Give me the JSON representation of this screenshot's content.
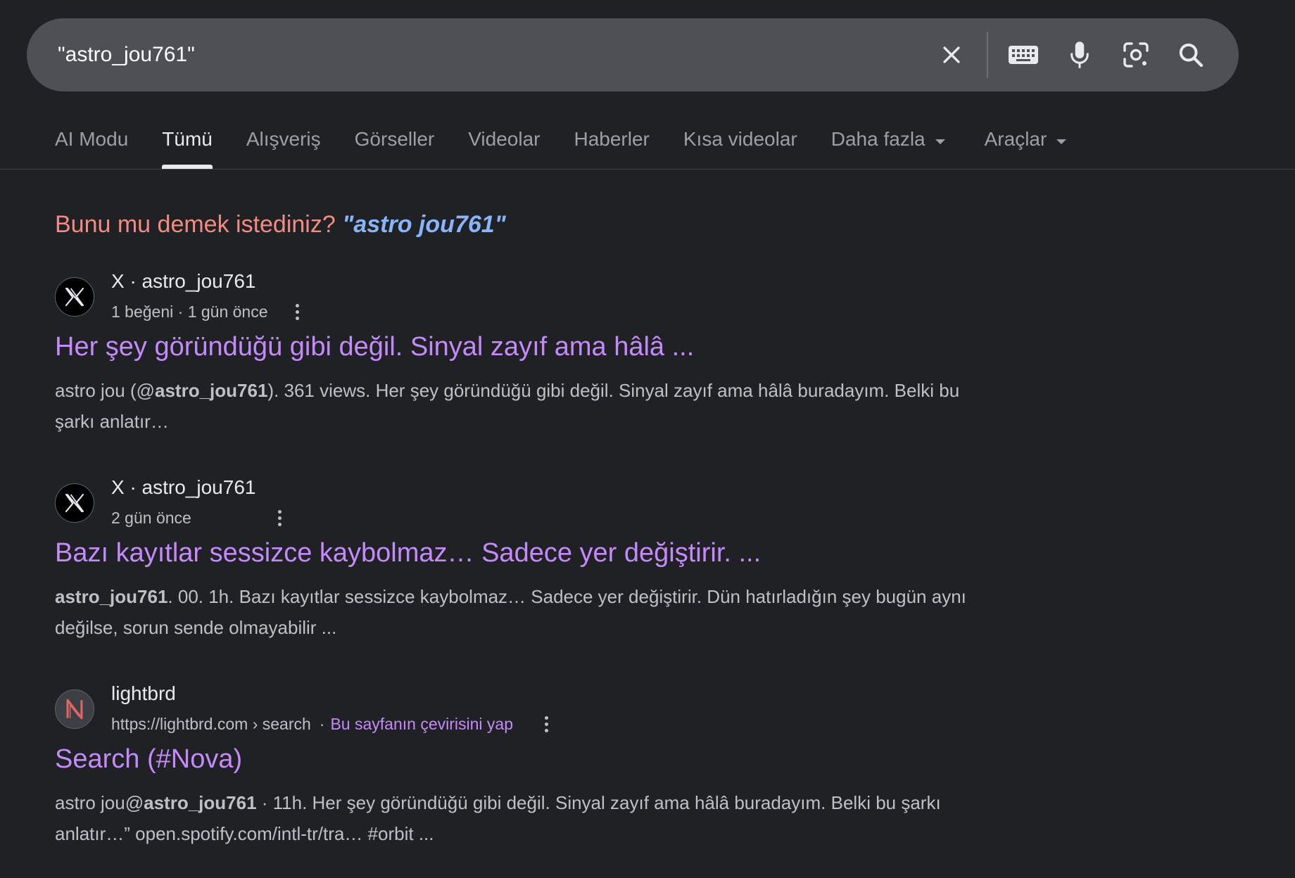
{
  "search": {
    "query": "\"astro_jou761\"",
    "clear_icon": "close-icon",
    "keyboard_icon": "keyboard-icon",
    "mic_icon": "microphone-icon",
    "lens_icon": "google-lens-icon",
    "search_icon": "search-icon"
  },
  "tabs": [
    {
      "label": "AI Modu",
      "active": false
    },
    {
      "label": "Tümü",
      "active": true
    },
    {
      "label": "Alışveriş",
      "active": false
    },
    {
      "label": "Görseller",
      "active": false
    },
    {
      "label": "Videolar",
      "active": false
    },
    {
      "label": "Haberler",
      "active": false
    },
    {
      "label": "Kısa videolar",
      "active": false
    },
    {
      "label": "Daha fazla",
      "active": false
    },
    {
      "label": "Araçlar",
      "active": false
    }
  ],
  "did_you_mean": {
    "prefix": "Bunu mu demek istediniz? ",
    "suggestion": "astro jou761"
  },
  "results": [
    {
      "site_name": "X · astro_jou761",
      "meta": "1 beğeni · 1 gün önce",
      "title": "Her şey göründüğü gibi değil. Sinyal zayıf ama hâlâ ...",
      "snippet_html": "astro jou (@<b>astro_jou761</b>). 361 views. Her şey göründüğü gibi değil. Sinyal zayıf ama hâlâ buradayım. Belki bu şarkı anlatır…"
    },
    {
      "site_name": "X · astro_jou761",
      "meta": "2 gün önce",
      "title": "Bazı kayıtlar sessizce kaybolmaz… Sadece yer değiştirir. ...",
      "snippet_html": "<b>astro_jou761</b>. 00. 1h. Bazı kayıtlar sessizce kaybolmaz… Sadece yer değiştirir. Dün hatırladığın şey bugün aynı değilse, sorun sende olmayabilir ..."
    },
    {
      "site_name": "lightbrd",
      "meta": "https://lightbrd.com › search",
      "translate": "Bu sayfanın çevirisini yap",
      "title": "Search (#Nova)",
      "snippet_html": "astro jou@<b>astro_jou761</b> · 11h. Her şey göründüğü gibi değil. Sinyal zayıf ama hâlâ buradayım. Belki bu şarkı anlatır…” open.spotify.com/intl-tr/tra… #orbit ..."
    }
  ],
  "colors": {
    "background": "#202124",
    "search_bar": "#4d5156",
    "visited_link": "#c58af9",
    "suggestion": "#8ab4f8",
    "did_you_mean": "#f28b82"
  }
}
